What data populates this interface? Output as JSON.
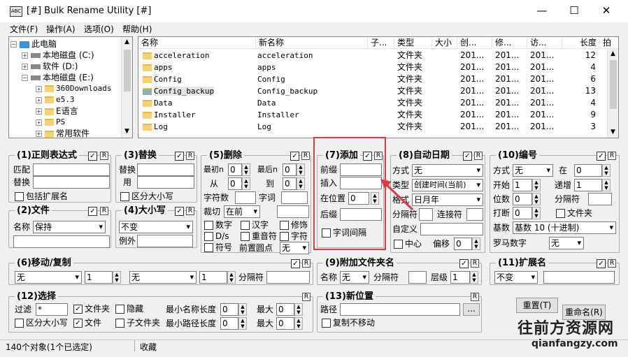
{
  "window": {
    "title": "[#] Bulk Rename Utility [#]",
    "app_icon_text": "ABC",
    "minimize": "—",
    "maximize": "☐",
    "close": "✕"
  },
  "menu": [
    "文件(F)",
    "操作(A)",
    "选项(O)",
    "帮助(H)"
  ],
  "tree": {
    "items": [
      "此电脑",
      "本地磁盘 (C:)",
      "软件 (D:)",
      "本地磁盘 (E:)",
      "360Downloads",
      "e5.3",
      "E语言",
      "PS",
      "常用软件"
    ]
  },
  "filelist": {
    "columns": [
      "名称",
      "新名称",
      "子...",
      "类型",
      "大小",
      "创...",
      "修...",
      "访...",
      "长度",
      "拍"
    ],
    "rows": [
      {
        "name": "acceleration",
        "newname": "acceleration",
        "type": "文件夹",
        "c": "201...",
        "m": "201...",
        "a": "201...",
        "len": "12"
      },
      {
        "name": "apps",
        "newname": "apps",
        "type": "文件夹",
        "c": "201...",
        "m": "201...",
        "a": "201...",
        "len": "4"
      },
      {
        "name": "Config",
        "newname": "Config",
        "type": "文件夹",
        "c": "201...",
        "m": "201...",
        "a": "201...",
        "len": "6"
      },
      {
        "name": "Config_backup",
        "newname": "Config_backup",
        "type": "文件夹",
        "c": "201...",
        "m": "201...",
        "a": "201...",
        "len": "13"
      },
      {
        "name": "Data",
        "newname": "Data",
        "type": "文件夹",
        "c": "201...",
        "m": "201...",
        "a": "201...",
        "len": "4"
      },
      {
        "name": "Installer",
        "newname": "Installer",
        "type": "文件夹",
        "c": "201...",
        "m": "201...",
        "a": "201...",
        "len": "9"
      },
      {
        "name": "Log",
        "newname": "Log",
        "type": "文件夹",
        "c": "201...",
        "m": "201...",
        "a": "201...",
        "len": "3"
      }
    ]
  },
  "p1": {
    "title": "(1)正则表达式",
    "match": "匹配",
    "replace": "替换",
    "incl_ext": "包括扩展名"
  },
  "p2": {
    "title": "(2)文件",
    "name_lbl": "名称",
    "name_val": "保持"
  },
  "p3": {
    "title": "(3)替换",
    "replace": "替换",
    "with": "用",
    "case": "区分大小写"
  },
  "p4": {
    "title": "(4)大小写",
    "val": "不变",
    "except": "例外"
  },
  "p5": {
    "title": "(5)删除",
    "firstn": "最初n",
    "lastn": "最后n",
    "from": "从",
    "to": "到",
    "chars": "字符数",
    "words": "字词",
    "crop": "裁切",
    "crop_val": "在前",
    "digits": "数字",
    "high": "汉字",
    "trim": "修饰",
    "ds": "D/s",
    "dup": "重音符",
    "chars2": "字符",
    "sym": "符号",
    "lead": "前置圆点",
    "lead_val": "无",
    "zero": "0"
  },
  "p7": {
    "title": "(7)添加",
    "prefix": "前缀",
    "insert": "插入",
    "atpos": "在位置",
    "atpos_val": "0",
    "suffix": "后缀",
    "wordspace": "字词间隔"
  },
  "p8": {
    "title": "(8)自动日期",
    "mode": "方式",
    "mode_val": "无",
    "type": "类型",
    "type_val": "创建时间(当前)",
    "fmt": "格式",
    "fmt_val": "日月年",
    "sep": "分隔符",
    "join": "连接符",
    "custom": "自定义",
    "center": "中心",
    "offset": "偏移",
    "offset_val": "0"
  },
  "p10": {
    "title": "(10)编号",
    "mode": "方式",
    "mode_val": "无",
    "at": "在",
    "at_val": "0",
    "start": "开始",
    "start_val": "1",
    "incr": "递增",
    "incr_val": "1",
    "pad": "位数",
    "pad_val": "0",
    "sep": "分隔符",
    "brk": "打断",
    "brk_val": "0",
    "folder": "文件夹",
    "base": "基数",
    "base_val": "基数 10 (十进制)",
    "roman": "罗马数字",
    "roman_val": "无"
  },
  "p6": {
    "title": "(6)移动/复制",
    "v1": "无",
    "n1": "1",
    "v2": "无",
    "n2": "1",
    "sep": "分隔符"
  },
  "p9": {
    "title": "(9)附加文件夹名",
    "name": "名称",
    "name_val": "无",
    "sep": "分隔符",
    "level": "层级",
    "level_val": "1"
  },
  "p11": {
    "title": "(11)扩展名",
    "val": "不变"
  },
  "p12": {
    "title": "(12)选择",
    "filter": "过滤",
    "filter_val": "*",
    "folders": "文件夹",
    "hidden": "隐藏",
    "minname": "最小名称长度",
    "minpath": "最小路径长度",
    "max": "最大",
    "zero": "0",
    "case": "区分大小写",
    "files": "文件",
    "subfolders": "子文件夹"
  },
  "p13": {
    "title": "(13)新位置",
    "path": "路径",
    "copy": "复制不移动",
    "browse": "..."
  },
  "buttons": {
    "reset": "重置(T)",
    "rename": "重命名(R)"
  },
  "rmark": "R",
  "status": {
    "count": "140个对象(1个已选定)",
    "fav": "收藏"
  },
  "watermark": {
    "line1": "往前方资源网",
    "line2": "qianfangzy.com"
  }
}
